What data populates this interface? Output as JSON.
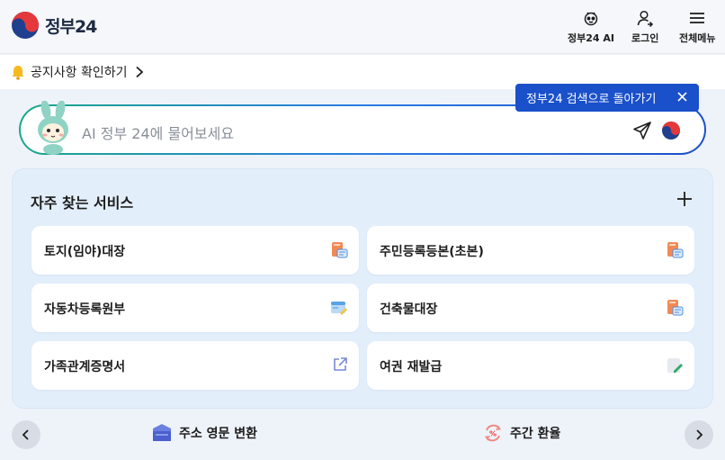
{
  "header": {
    "logo_text": "정부24",
    "ai_label": "정부24 AI",
    "login_label": "로그인",
    "menu_label": "전체메뉴"
  },
  "notice": {
    "text": "공지사항 확인하기"
  },
  "tooltip": {
    "text": "정부24 검색으로 돌아가기"
  },
  "search": {
    "placeholder": "AI 정부 24에 물어보세요"
  },
  "services": {
    "title": "자주 찾는 서비스",
    "items": [
      {
        "label": "토지(임야)대장",
        "icon": "document-icon"
      },
      {
        "label": "주민등록등본(초본)",
        "icon": "document-icon"
      },
      {
        "label": "자동차등록원부",
        "icon": "car-document-icon"
      },
      {
        "label": "건축물대장",
        "icon": "document-icon"
      },
      {
        "label": "가족관계증명서",
        "icon": "external-link-icon"
      },
      {
        "label": "여권 재발급",
        "icon": "edit-document-icon"
      }
    ]
  },
  "bottom": {
    "items": [
      {
        "label": "주소 영문 변환",
        "icon": "address-icon"
      },
      {
        "label": "주간 환율",
        "icon": "exchange-rate-icon"
      }
    ]
  },
  "colors": {
    "accent": "#1a50c9",
    "panel_bg": "#e3eefb",
    "brand_red": "#e5383b",
    "brand_blue": "#1f3f8f"
  }
}
